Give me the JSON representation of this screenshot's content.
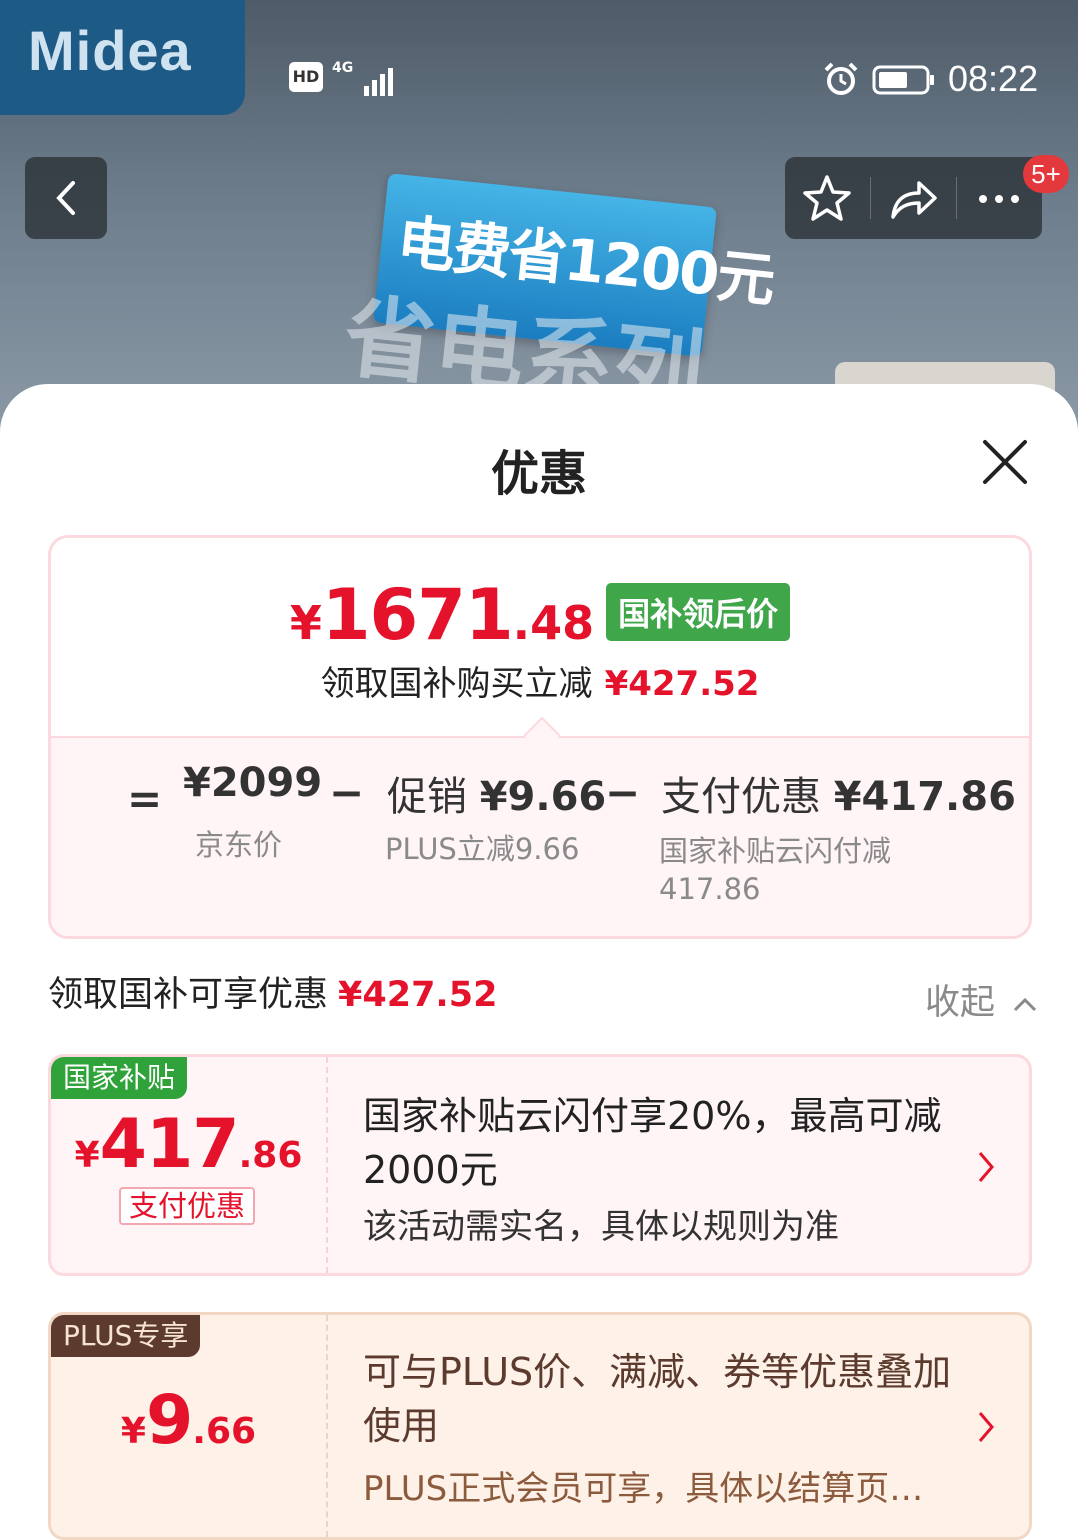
{
  "status_bar": {
    "hd": "HD",
    "network": "4G",
    "time": "08:22"
  },
  "banner": {
    "brand": "Midea",
    "promo": "电费省1200元",
    "promo_sub": "省电系列"
  },
  "header": {
    "badge": "5+"
  },
  "sheet": {
    "title": "优惠",
    "summary": {
      "currency": "¥",
      "price_int": "1671",
      "price_dec": ".48",
      "price_tag": "国补领后价",
      "save_text": "领取国补购买立减",
      "save_amount": "¥427.52",
      "equals": "=",
      "minus": "−",
      "jd_price": "¥2099",
      "jd_label": "京东价",
      "promo_label": "促销",
      "promo_value": "¥9.66",
      "promo_note": "PLUS立减9.66",
      "pay_label": "支付优惠",
      "pay_value": "¥417.86",
      "pay_note": "国家补贴云闪付减417.86"
    },
    "section": {
      "title": "领取国补可享优惠",
      "amount": "¥427.52",
      "collapse": "收起"
    },
    "cards": [
      {
        "corner": "国家补贴",
        "currency": "¥",
        "int": "417",
        "dec": ".86",
        "tag": "支付优惠",
        "desc": "国家补贴云闪付享20%，最高可减2000元",
        "note": "该活动需实名，具体以规则为准"
      },
      {
        "corner": "PLUS专享",
        "currency": "¥",
        "int": "9",
        "dec": ".66",
        "desc": "可与PLUS价、满减、券等优惠叠加使用",
        "note": "PLUS正式会员可享，具体以结算页为准"
      }
    ]
  },
  "colors": {
    "accent_red": "#e4122b",
    "subsidy_green": "#3fa64a",
    "plus_brown": "#5c3b2e"
  }
}
